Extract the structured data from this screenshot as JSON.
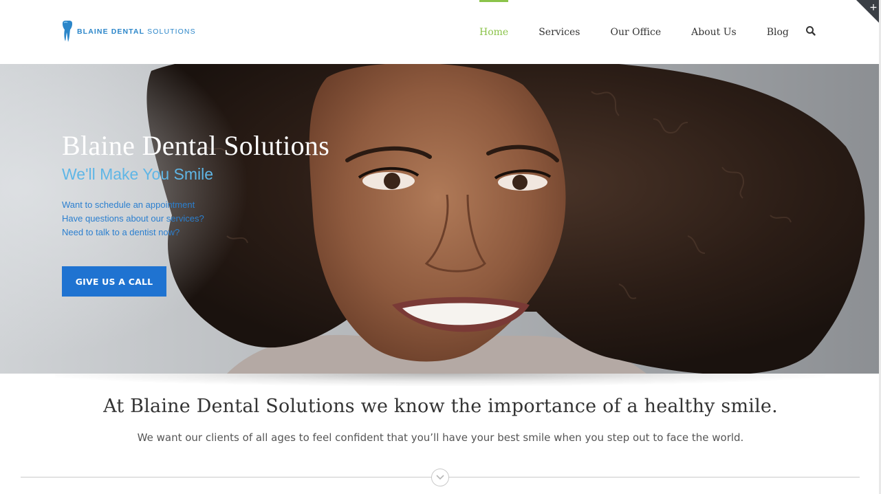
{
  "brand": {
    "name_bold": "BLAINE DENTAL",
    "name_light": "SOLUTIONS",
    "logo_icon": "tooth-icon",
    "color": "#2b86c9"
  },
  "nav": {
    "items": [
      {
        "label": "Home",
        "active": true
      },
      {
        "label": "Services",
        "active": false
      },
      {
        "label": "Our Office",
        "active": false
      },
      {
        "label": "About Us",
        "active": false
      },
      {
        "label": "Blog",
        "active": false
      }
    ],
    "active_color": "#8bc34a",
    "search_icon": "search-icon"
  },
  "corner": {
    "label": "+"
  },
  "hero": {
    "title": "Blaine Dental Solutions",
    "subtitle": "We'll Make You Smile",
    "lines": [
      "Want to schedule an appointment",
      "Have questions about our services?",
      "Need to talk to a dentist now?"
    ],
    "cta_label": "GIVE US A CALL",
    "cta_color": "#1f73d1"
  },
  "intro": {
    "title": "At Blaine Dental Solutions we know the importance of a healthy smile.",
    "text": "We want our clients of all ages to feel confident that you’ll have your best smile when you step out to face the world."
  },
  "divider": {
    "icon": "chevron-down-icon"
  }
}
